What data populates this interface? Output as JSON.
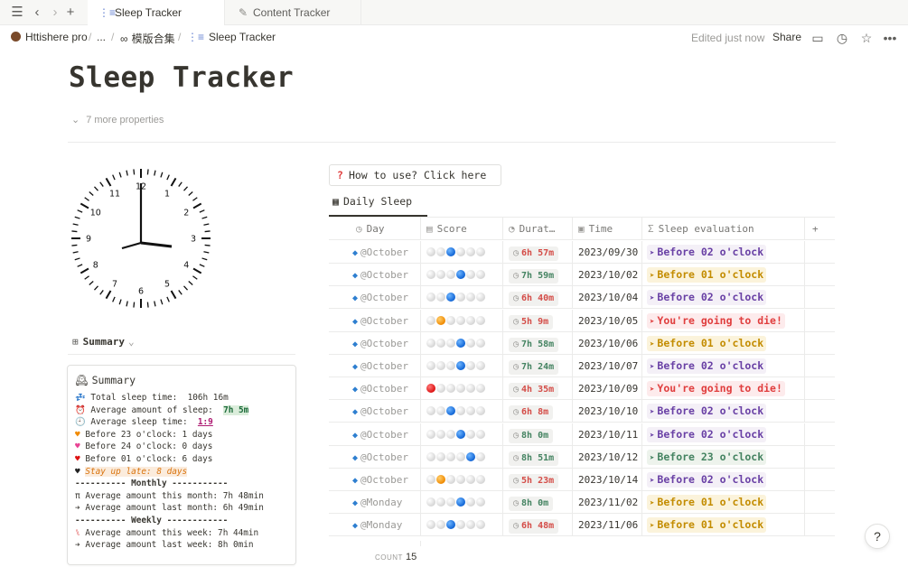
{
  "tabbar": {
    "tabs": [
      {
        "label": "Sleep Tracker",
        "icon": "list-icon",
        "active": true
      },
      {
        "label": "Content Tracker",
        "icon": "pencil-icon",
        "active": false
      }
    ]
  },
  "breadcrumb": {
    "workspace": "Httishere pro",
    "ellipsis": "...",
    "parent": "模版合集",
    "current": "Sleep Tracker"
  },
  "topbar": {
    "edited": "Edited just now",
    "share": "Share"
  },
  "page": {
    "title": "Sleep Tracker",
    "more_properties": "7 more properties"
  },
  "clock": {
    "numbers": [
      "12",
      "1",
      "2",
      "3",
      "4",
      "5",
      "6",
      "7",
      "8",
      "9",
      "10",
      "11"
    ],
    "hour_hand_time": "3:00"
  },
  "summary": {
    "view_label": "Summary",
    "card_title": "Summary",
    "total_label": "Total sleep time:  106h 16m",
    "average_amount_label": "Average amount of sleep:  ",
    "average_amount_value": "7h 5m",
    "average_time_label": "Average sleep time:  ",
    "average_time_value": "1:9",
    "before23": "Before 23 o'clock: 1 days",
    "before24": "Before 24 o'clock: 0 days",
    "before01": "Before 01 o'clock: 6 days",
    "stay_up": "Stay up late: 8 days",
    "monthly_sep": "---------- Monthly -----------",
    "this_month": "Average amount this month: 7h 48min",
    "last_month": "Average amount last month: 6h 49min",
    "weekly_sep": "---------- Weekly ------------",
    "this_week": "Average amount this week: 7h 44min",
    "last_week": "Average amount last week: 8h 0min"
  },
  "database": {
    "howto": "How to use? Click here",
    "view_tab": "Daily Sleep",
    "columns": [
      "Day",
      "Score",
      "Durat…",
      "Time",
      "Sleep evaluation"
    ],
    "rows": [
      {
        "day": "@October",
        "score": [
          "w",
          "w",
          "b",
          "w",
          "w",
          "w"
        ],
        "duration": "6h 57m",
        "dur_color": "red",
        "time": "2023/09/30",
        "eval": "Before 02 o'clock",
        "eval_color": "purple"
      },
      {
        "day": "@October",
        "score": [
          "w",
          "w",
          "w",
          "b",
          "w",
          "w"
        ],
        "duration": "7h 59m",
        "dur_color": "green",
        "time": "2023/10/02",
        "eval": "Before 01 o'clock",
        "eval_color": "yellow"
      },
      {
        "day": "@October",
        "score": [
          "w",
          "w",
          "b",
          "w",
          "w",
          "w"
        ],
        "duration": "6h 40m",
        "dur_color": "red",
        "time": "2023/10/04",
        "eval": "Before 02 o'clock",
        "eval_color": "purple"
      },
      {
        "day": "@October",
        "score": [
          "w",
          "o",
          "w",
          "w",
          "w",
          "w"
        ],
        "duration": "5h 9m",
        "dur_color": "red",
        "time": "2023/10/05",
        "eval": "You're going to die!",
        "eval_color": "red"
      },
      {
        "day": "@October",
        "score": [
          "w",
          "w",
          "w",
          "b",
          "w",
          "w"
        ],
        "duration": "7h 58m",
        "dur_color": "green",
        "time": "2023/10/06",
        "eval": "Before 01 o'clock",
        "eval_color": "yellow"
      },
      {
        "day": "@October",
        "score": [
          "w",
          "w",
          "w",
          "b",
          "w",
          "w"
        ],
        "duration": "7h 24m",
        "dur_color": "green",
        "time": "2023/10/07",
        "eval": "Before 02 o'clock",
        "eval_color": "purple"
      },
      {
        "day": "@October",
        "score": [
          "r",
          "w",
          "w",
          "w",
          "w",
          "w"
        ],
        "duration": "4h 35m",
        "dur_color": "red",
        "time": "2023/10/09",
        "eval": "You're going to die!",
        "eval_color": "red"
      },
      {
        "day": "@October",
        "score": [
          "w",
          "w",
          "b",
          "w",
          "w",
          "w"
        ],
        "duration": "6h 8m",
        "dur_color": "red",
        "time": "2023/10/10",
        "eval": "Before 02 o'clock",
        "eval_color": "purple"
      },
      {
        "day": "@October",
        "score": [
          "w",
          "w",
          "w",
          "b",
          "w",
          "w"
        ],
        "duration": "8h 0m",
        "dur_color": "green",
        "time": "2023/10/11",
        "eval": "Before 02 o'clock",
        "eval_color": "purple"
      },
      {
        "day": "@October",
        "score": [
          "w",
          "w",
          "w",
          "w",
          "b",
          "w"
        ],
        "duration": "8h 51m",
        "dur_color": "green",
        "time": "2023/10/12",
        "eval": "Before 23 o'clock",
        "eval_color": "green"
      },
      {
        "day": "@October",
        "score": [
          "w",
          "o",
          "w",
          "w",
          "w",
          "w"
        ],
        "duration": "5h 23m",
        "dur_color": "red",
        "time": "2023/10/14",
        "eval": "Before 02 o'clock",
        "eval_color": "purple"
      },
      {
        "day": "@Monday",
        "score": [
          "w",
          "w",
          "w",
          "b",
          "w",
          "w"
        ],
        "duration": "8h 0m",
        "dur_color": "green",
        "time": "2023/11/02",
        "eval": "Before 01 o'clock",
        "eval_color": "yellow"
      },
      {
        "day": "@Monday",
        "score": [
          "w",
          "w",
          "b",
          "w",
          "w",
          "w"
        ],
        "duration": "6h 48m",
        "dur_color": "red",
        "time": "2023/11/06",
        "eval": "Before 01 o'clock",
        "eval_color": "yellow"
      }
    ],
    "count_label": "COUNT",
    "count_value": "15"
  },
  "help": "?"
}
